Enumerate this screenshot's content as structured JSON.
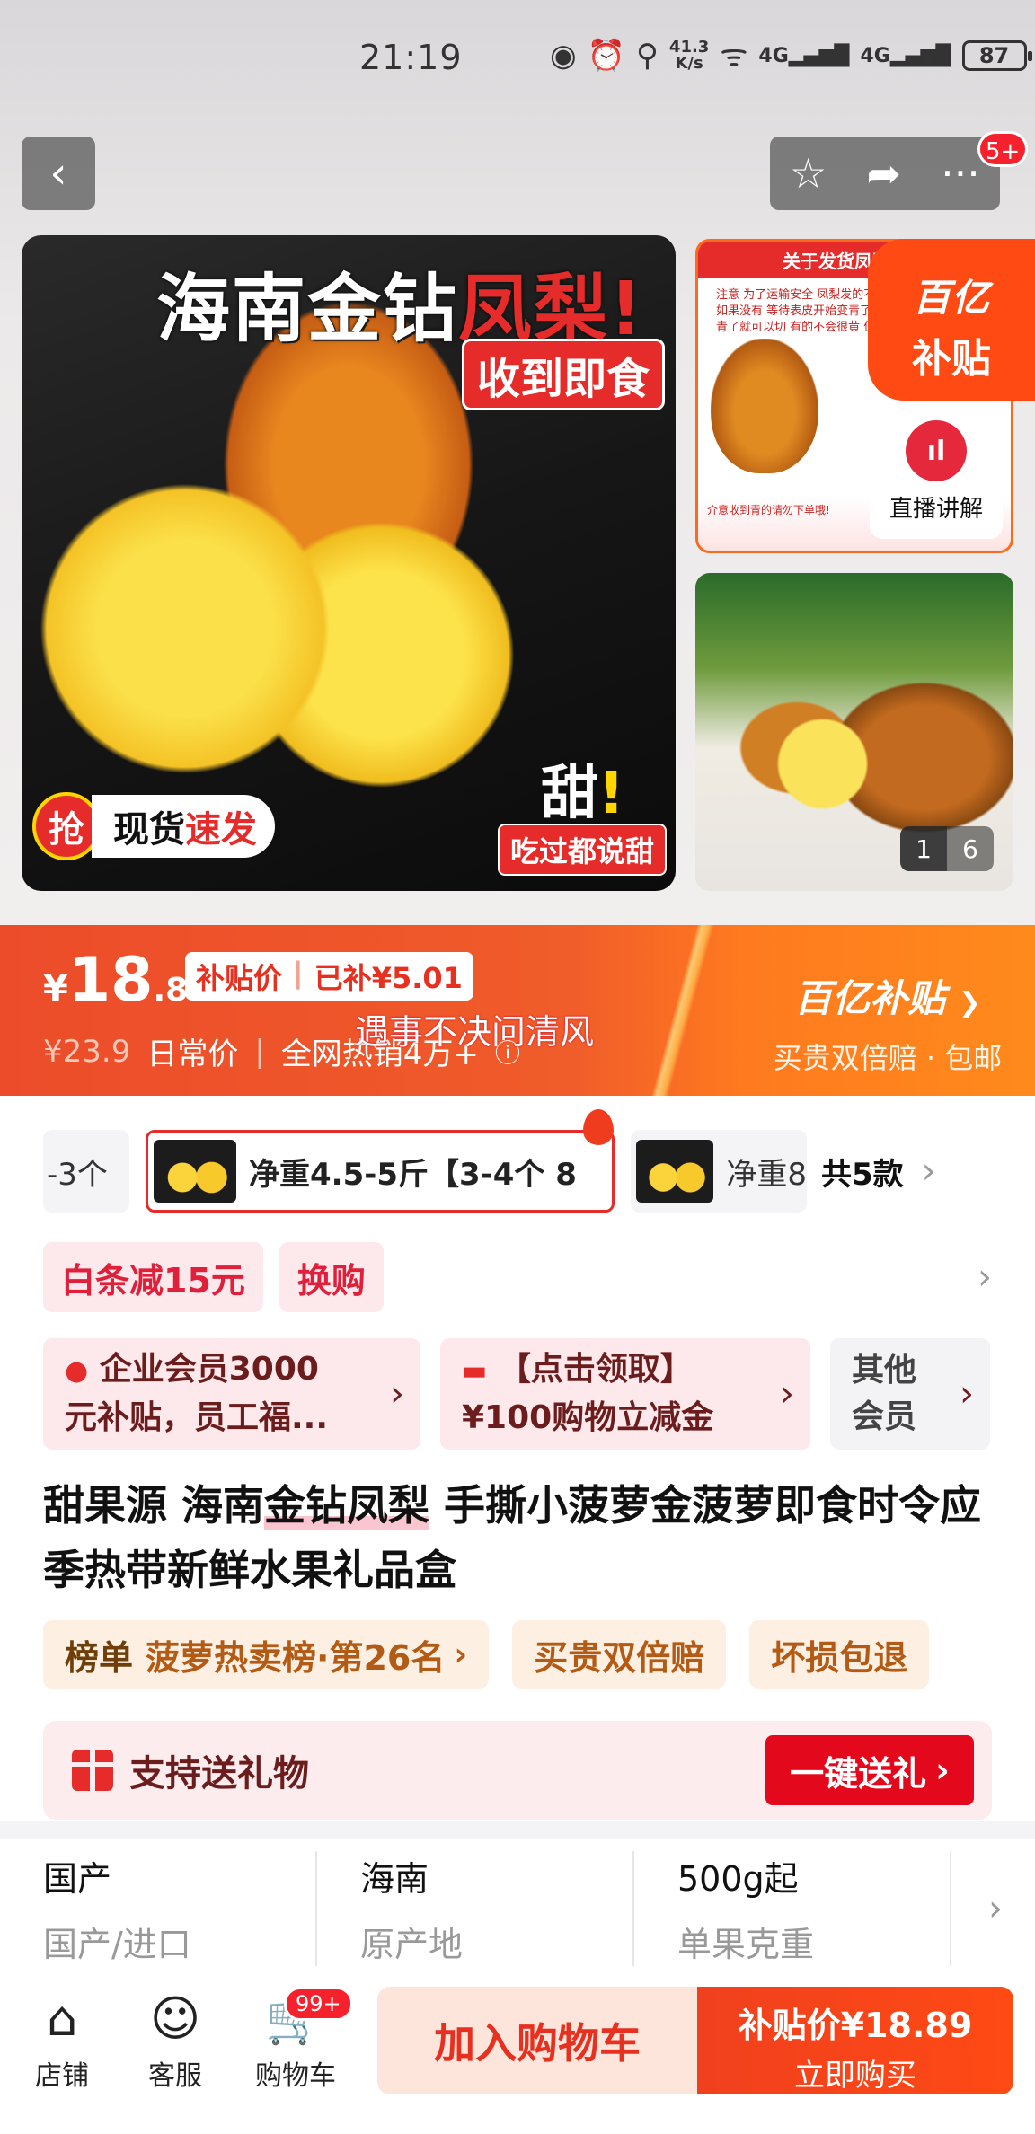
{
  "status_bar": {
    "time": "21:19",
    "net_speed_value": "41.3",
    "net_speed_unit": "K/s",
    "network_1": "4G",
    "network_2": "4G",
    "battery": "87"
  },
  "header": {
    "back_icon": "chevron-left-icon",
    "favorite_icon": "star-icon",
    "share_icon": "share-icon",
    "more_icon": "more-icon",
    "more_badge": "5+"
  },
  "gallery": {
    "main_title_part1": "海南金钻",
    "main_title_part2": "凤梨!",
    "main_subtitle": "收到即食",
    "grab_badge": "抢",
    "grab_text_part1": "现货",
    "grab_text_part2": "速发",
    "sweet_word": "甜",
    "sweet_mark": "!",
    "sweet_tag": "吃过都说甜",
    "notice_header": "关于发货凤梨注意",
    "notice_lines": "注意 为了运输安全 凤梨发的不是很青了 或者有香味了,如果没有 等待表皮开始变青了在切 左图是放了几天的 青了就可以切 有的不会很黄 但是很香 也可以切开",
    "notice_footer": "介意收到青的请勿下单哦!",
    "subsidy_brand": "百亿",
    "subsidy_word": "补贴",
    "live_label": "直播讲解",
    "photo_current": "1",
    "photo_total": "6"
  },
  "price_banner": {
    "currency": "¥",
    "price_int": "18",
    "price_dec": ".89",
    "subsidy_label": "补贴价",
    "subsidy_amount": "已补¥5.01",
    "old_price": "¥23.9",
    "old_price_label": "日常价",
    "sales_text": "全网热销4万+",
    "marquee": "遇事不决问清风",
    "brand": "百亿补贴",
    "promise": "买贵双倍赔 · 包邮"
  },
  "sku": {
    "prev_label": "-3个",
    "active_label": "净重4.5-5斤【3-4个 8",
    "next_label": "净重8",
    "total": "共5款"
  },
  "promos": [
    "白条减15元",
    "换购"
  ],
  "members": {
    "card1_line1": "企业会员3000",
    "card1_line2": "元补贴，员工福...",
    "card2_line1": "【点击领取】",
    "card2_line2": "¥100购物立减金",
    "card3_line1": "其他",
    "card3_line2": "会员"
  },
  "product": {
    "title_part1": "甜果源 海南",
    "title_highlight": "金钻凤梨",
    "title_part2": " 手撕小菠萝金菠萝即食时令应季热带新鲜水果礼品盒"
  },
  "rank": {
    "label": "榜单",
    "text": "菠萝热卖榜·第26名",
    "tag2": "买贵双倍赔",
    "tag3": "坏损包退"
  },
  "gift": {
    "text": "支持送礼物",
    "button": "一键送礼"
  },
  "specs": [
    {
      "value": "国产",
      "key": "国产/进口"
    },
    {
      "value": "海南",
      "key": "原产地"
    },
    {
      "value": "500g起",
      "key": "单果克重"
    }
  ],
  "bottom_bar": {
    "shop": "店铺",
    "service": "客服",
    "cart": "购物车",
    "cart_badge": "99+",
    "add_cart": "加入购物车",
    "buy_price": "补贴价¥18.89",
    "buy_now": "立即购买"
  },
  "colors": {
    "accent": "#e62b2b",
    "subsidy_orange": "#ff4a14",
    "promo_bg": "#fde8eb"
  }
}
